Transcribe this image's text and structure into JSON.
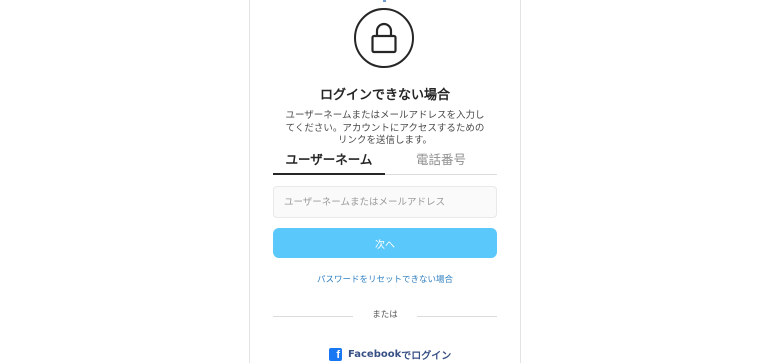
{
  "header": {
    "title": "ログインできない場合",
    "description_lines": [
      "ユーザーネームまたはメールアドレスを入力し",
      "てください。アカウントにアクセスするための",
      "リンクを送信します。"
    ]
  },
  "icons": {
    "lock": "lock-icon",
    "facebook": "facebook-icon"
  },
  "tabs": [
    {
      "label": "ユーザーネーム",
      "active": true
    },
    {
      "label": "電話番号",
      "active": false
    }
  ],
  "form": {
    "input_placeholder": "ユーザーネームまたはメールアドレス",
    "input_value": "",
    "next_label": "次へ"
  },
  "links": {
    "reset_password": "パスワードをリセットできない場合"
  },
  "divider": {
    "or_label": "または"
  },
  "facebook": {
    "brand": "Facebook",
    "suffix": "でログイン"
  },
  "colors": {
    "accent_button": "#5ac8fa",
    "link": "#2f7fc0",
    "facebook_text": "#385185",
    "facebook_icon": "#1877f2"
  }
}
